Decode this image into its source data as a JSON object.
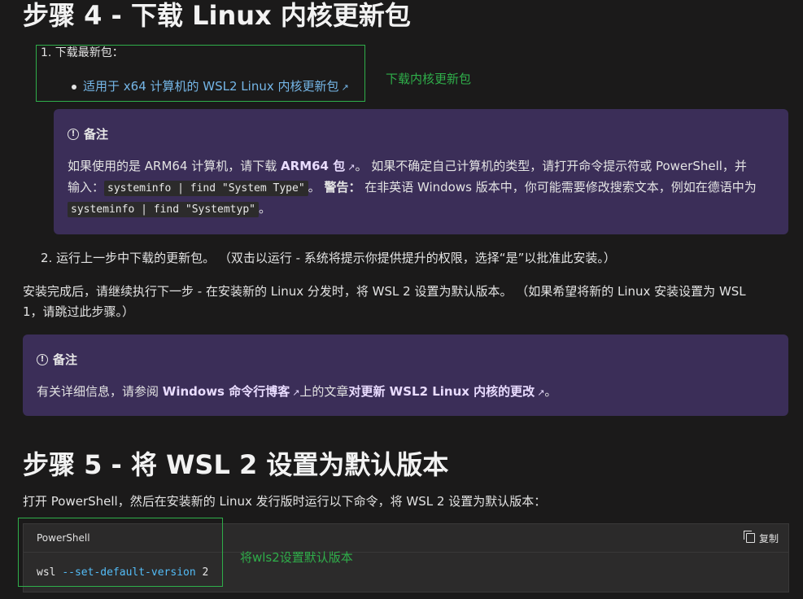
{
  "step4": {
    "heading": "步骤 4 - 下载 Linux 内核更新包",
    "item1_label": "1. 下载最新包：",
    "item1_link": "适用于 x64 计算机的 WSL2 Linux 内核更新包",
    "annotation1": "下载内核更新包",
    "note1": {
      "title": "备注",
      "line1_pre": "如果使用的是 ARM64 计算机，请下载 ",
      "line1_link": "ARM64 包",
      "line1_post": "。 如果不确定自己计算机的类型，请打开命令提示符或 PowerShell，并",
      "line2_pre": "输入：",
      "code1": "systeminfo | find \"System Type\"",
      "line2_mid": "。 ",
      "warning": "警告：",
      "line2_post": " 在非英语 Windows 版本中，你可能需要修改搜索文本，例如在德语中为",
      "code2": "systeminfo | find \"Systemtyp\"",
      "line3_post": "。"
    },
    "item2": "2. 运行上一步中下载的更新包。 （双击以运行 - 系统将提示你提供提升的权限，选择“是”以批准此安装。）",
    "after_line1": "安装完成后，请继续执行下一步 - 在安装新的 Linux 分发时，将 WSL 2 设置为默认版本。 （如果希望将新的 Linux 安装设置为 WSL",
    "after_line2": "1，请跳过此步骤。）",
    "note2": {
      "title": "备注",
      "pre": "有关详细信息，请参阅 ",
      "link1": "Windows 命令行博客",
      "mid": "上的文章",
      "link2": "对更新 WSL2 Linux 内核的更改",
      "post": "。"
    }
  },
  "step5": {
    "heading": "步骤 5 - 将 WSL 2 设置为默认版本",
    "intro": "打开 PowerShell，然后在安装新的 Linux 发行版时运行以下命令，将 WSL 2 设置为默认版本：",
    "code_lang": "PowerShell",
    "copy_label": "复制",
    "code_cmd": "wsl",
    "code_param": "--set-default-version",
    "code_value": "2",
    "annotation2": "将wls2设置默认版本"
  },
  "colors": {
    "background": "#1b1a1a",
    "note_bg": "#3b2e58",
    "link": "#75b6e7",
    "annotation_green": "#2fae4a"
  },
  "icons": [
    "external-link-icon",
    "info-icon",
    "copy-icon",
    "bullet-icon"
  ]
}
